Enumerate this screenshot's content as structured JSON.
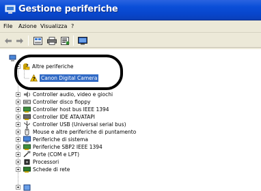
{
  "window": {
    "title": "Gestione periferiche"
  },
  "menu": {
    "items": [
      "File",
      "Azione",
      "Visualizza",
      "?"
    ]
  },
  "toolbar": {
    "icons": [
      "back-arrow-icon",
      "forward-arrow-icon",
      "view-icon",
      "print-icon",
      "properties-icon",
      "scan-hardware-icon"
    ]
  },
  "tree": {
    "group": {
      "label": "Altre periferiche",
      "child": "Canon Digital Camera"
    },
    "items": [
      "Controller audio, video e giochi",
      "Controller disco floppy",
      "Controller host bus IEEE 1394",
      "Controller IDE ATA/ATAPI",
      "Controller USB (Universal serial bus)",
      "Mouse e altre periferiche di puntamento",
      "Periferiche di sistema",
      "Periferiche SBP2 IEEE 1394",
      "Porte (COM e LPT)",
      "Processori",
      "Schede di rete"
    ]
  },
  "colors": {
    "titlebar": "#0a4ed8",
    "selection": "#316ac5",
    "warning": "#f2c000"
  }
}
